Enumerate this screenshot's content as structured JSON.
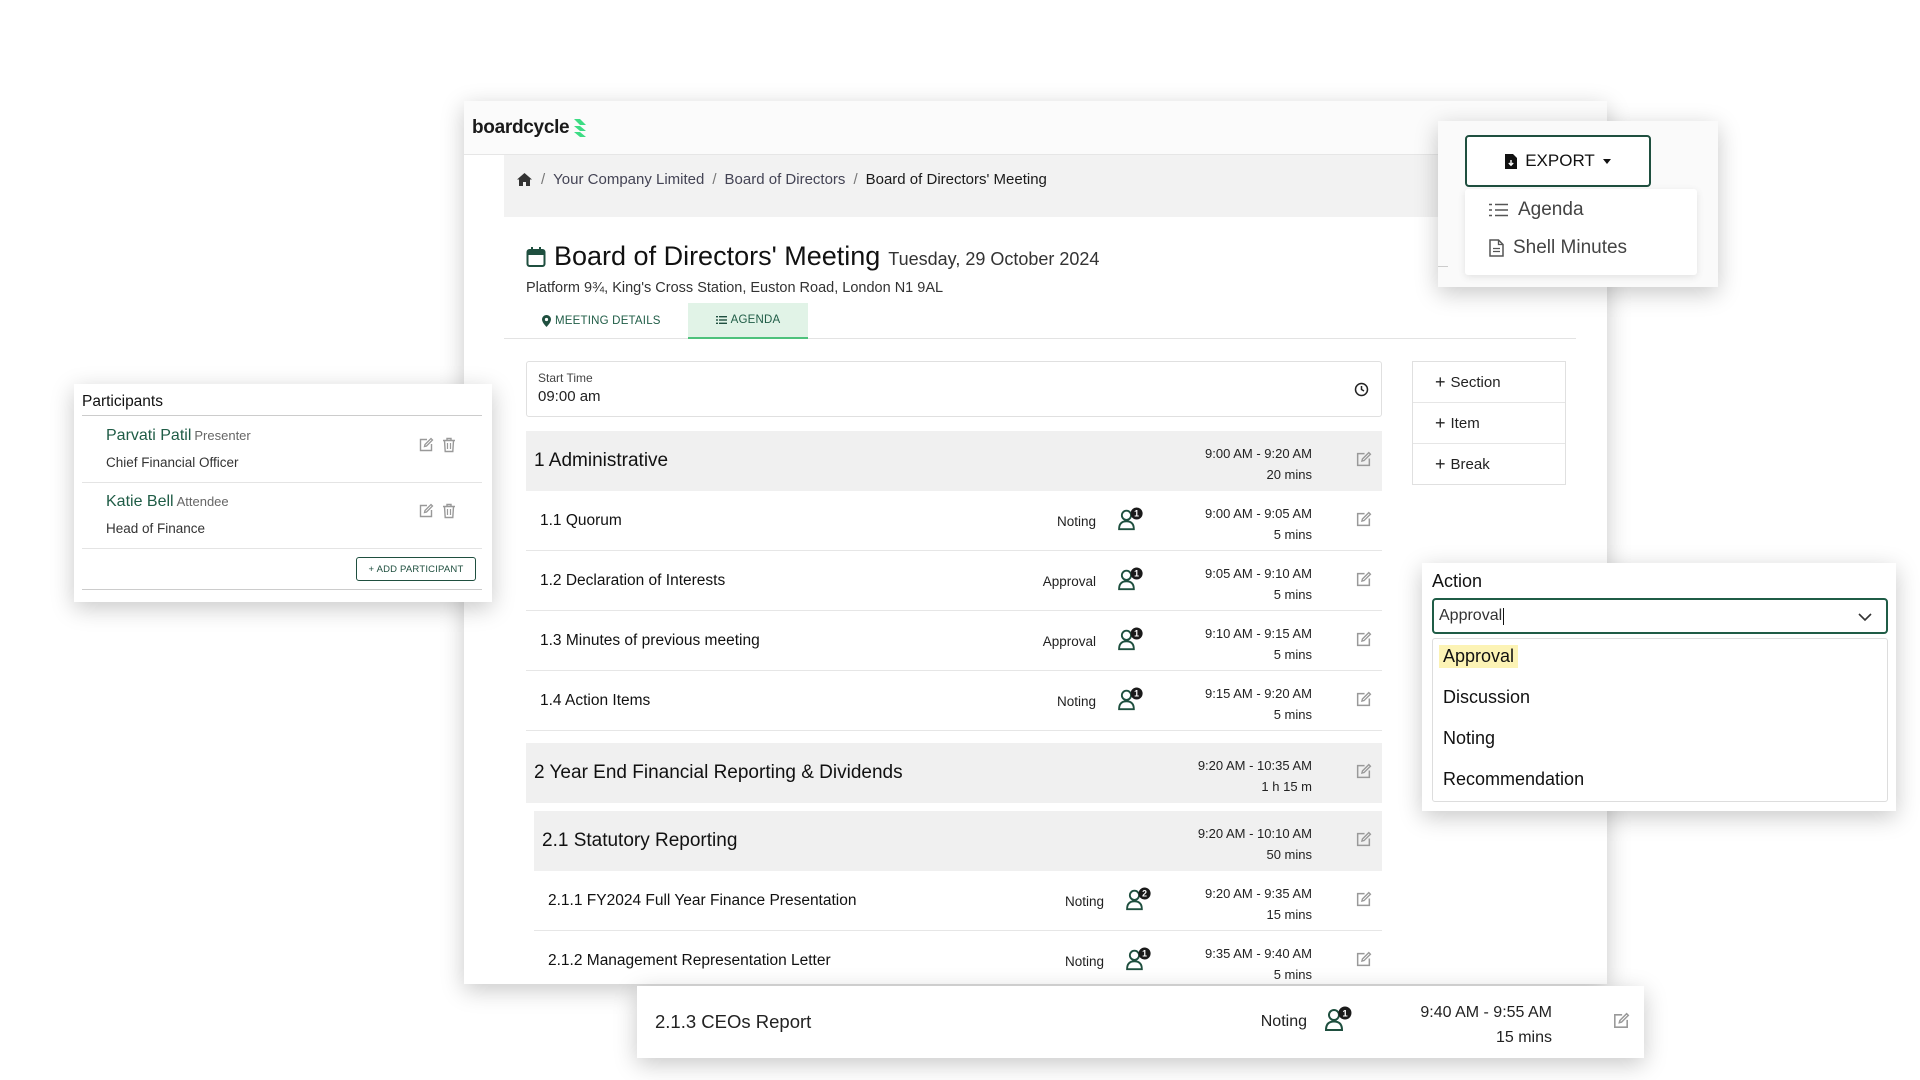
{
  "brand": {
    "name": "boardcycle",
    "accent": "#3ddc84"
  },
  "breadcrumb": [
    "Your Company Limited",
    "Board of Directors",
    "Board of Directors' Meeting"
  ],
  "meeting": {
    "title": "Board of Directors' Meeting",
    "date": "Tuesday, 29 October 2024",
    "location": "Platform 9¾, King's Cross Station, Euston Road, London N1 9AL"
  },
  "tabs": {
    "details": "MEETING DETAILS",
    "agenda": "AGENDA"
  },
  "start_time": {
    "label": "Start Time",
    "value": "09:00 am"
  },
  "agenda": [
    {
      "name": "1 Administrative",
      "time": "9:00 AM - 9:20 AM",
      "duration": "20 mins"
    },
    {
      "name": "1.1 Quorum",
      "action": "Noting",
      "badge": "1",
      "time": "9:00 AM - 9:05 AM",
      "duration": "5 mins"
    },
    {
      "name": "1.2 Declaration of Interests",
      "action": "Approval",
      "badge": "1",
      "time": "9:05 AM - 9:10 AM",
      "duration": "5 mins"
    },
    {
      "name": "1.3 Minutes of previous meeting",
      "action": "Approval",
      "badge": "1",
      "time": "9:10 AM - 9:15 AM",
      "duration": "5 mins"
    },
    {
      "name": "1.4 Action Items",
      "action": "Noting",
      "badge": "1",
      "time": "9:15 AM - 9:20 AM",
      "duration": "5 mins"
    },
    {
      "name": "2 Year End Financial Reporting & Dividends",
      "time": "9:20 AM - 10:35 AM",
      "duration": "1 h 15 m"
    },
    {
      "name": "2.1 Statutory Reporting",
      "time": "9:20 AM - 10:10 AM",
      "duration": "50 mins"
    },
    {
      "name": "2.1.1 FY2024 Full Year Finance Presentation",
      "action": "Noting",
      "badge": "2",
      "time": "9:20 AM - 9:35 AM",
      "duration": "15 mins"
    },
    {
      "name": "2.1.2 Management Representation Letter",
      "action": "Noting",
      "badge": "1",
      "time": "9:35 AM - 9:40 AM",
      "duration": "5 mins"
    }
  ],
  "add_buttons": {
    "section": "Section",
    "item": "Item",
    "break": "Break"
  },
  "participants": {
    "title": "Participants",
    "list": [
      {
        "name": "Parvati Patil",
        "role": "Presenter",
        "job": "Chief Financial Officer"
      },
      {
        "name": "Katie Bell",
        "role": "Attendee",
        "job": "Head of Finance"
      }
    ],
    "add_label": "+ ADD PARTICIPANT"
  },
  "export": {
    "label": "EXPORT",
    "items": [
      "Agenda",
      "Shell Minutes"
    ]
  },
  "action_select": {
    "label": "Action",
    "value": "Approval",
    "options": [
      "Approval",
      "Discussion",
      "Noting",
      "Recommendation"
    ]
  },
  "ceo_row": {
    "name": "2.1.3 CEOs Report",
    "action": "Noting",
    "badge": "1",
    "time": "9:40 AM - 9:55 AM",
    "duration": "15 mins"
  }
}
